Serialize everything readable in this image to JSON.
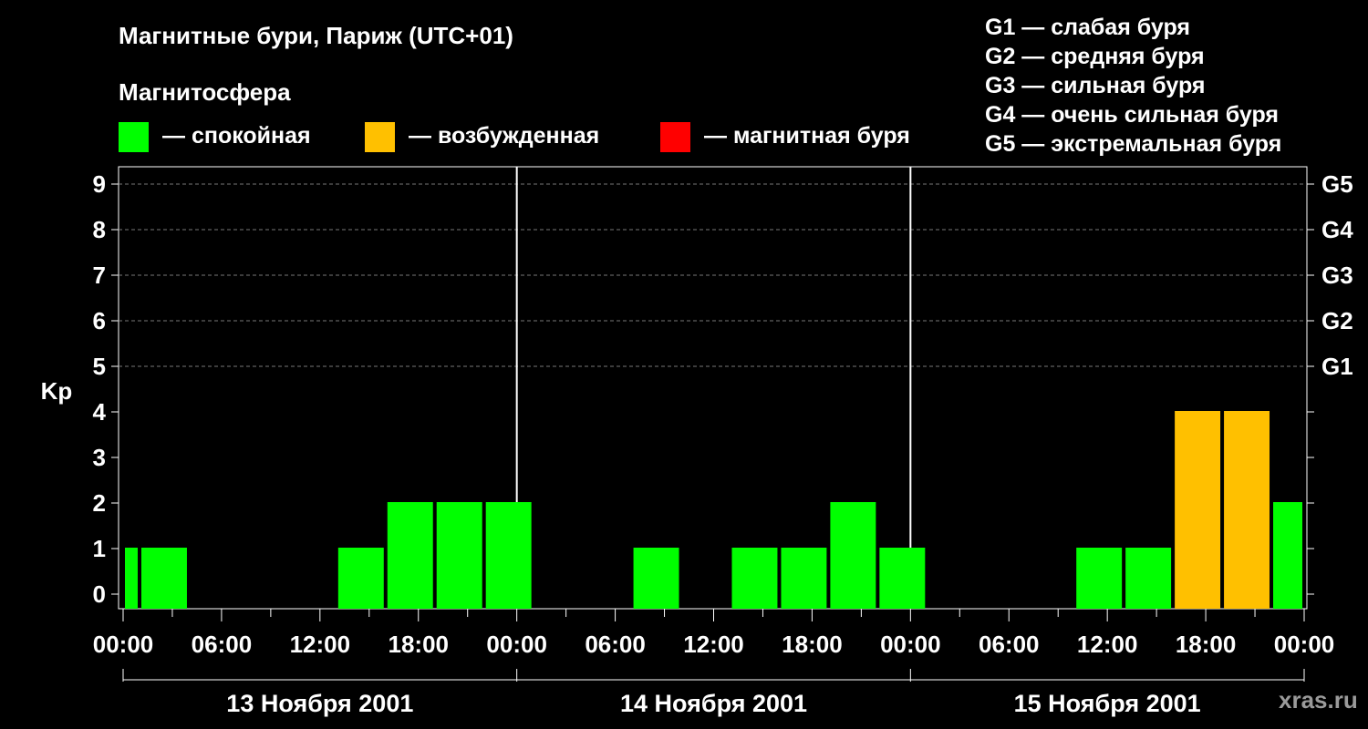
{
  "title": "Магнитные бури, Париж (UTC+01)",
  "subtitle": "Магнитосфера",
  "legend": [
    {
      "label": "— спокойная",
      "color": "#00ff00"
    },
    {
      "label": "— возбужденная",
      "color": "#ffc000"
    },
    {
      "label": "— магнитная буря",
      "color": "#ff0000"
    }
  ],
  "g_legend": [
    "G1 — слабая буря",
    "G2 — средняя буря",
    "G3 — сильная буря",
    "G4 — очень сильная буря",
    "G5 — экстремальная буря"
  ],
  "watermark": "xras.ru",
  "chart_data": {
    "type": "bar",
    "title": "Магнитные бури, Париж (UTC+01)",
    "ylabel": "Kp",
    "ylim": [
      0,
      9
    ],
    "yticks": [
      0,
      1,
      2,
      3,
      4,
      5,
      6,
      7,
      8,
      9
    ],
    "right_ticks": [
      {
        "value": 5,
        "label": "G1"
      },
      {
        "value": 6,
        "label": "G2"
      },
      {
        "value": 7,
        "label": "G3"
      },
      {
        "value": 8,
        "label": "G4"
      },
      {
        "value": 9,
        "label": "G5"
      }
    ],
    "grid": "dashed horizontal lines at Kp 5–9",
    "x_tick_labels": [
      "00:00",
      "06:00",
      "12:00",
      "18:00",
      "00:00",
      "06:00",
      "12:00",
      "18:00",
      "00:00",
      "06:00",
      "12:00",
      "18:00",
      "00:00"
    ],
    "dates": [
      "13 Ноября 2001",
      "14 Ноября 2001",
      "15 Ноября 2001"
    ],
    "bars": [
      {
        "day": "13 Ноября 2001",
        "start": "00:00",
        "end": "01:00",
        "kp": 1,
        "level": "спокойная"
      },
      {
        "day": "13 Ноября 2001",
        "start": "01:00",
        "end": "04:00",
        "kp": 1,
        "level": "спокойная"
      },
      {
        "day": "13 Ноября 2001",
        "start": "13:00",
        "end": "16:00",
        "kp": 1,
        "level": "спокойная"
      },
      {
        "day": "13 Ноября 2001",
        "start": "16:00",
        "end": "19:00",
        "kp": 2,
        "level": "спокойная"
      },
      {
        "day": "13 Ноября 2001",
        "start": "19:00",
        "end": "22:00",
        "kp": 2,
        "level": "спокойная"
      },
      {
        "day": "13 Ноября 2001",
        "start": "22:00",
        "end": "01:00",
        "kp": 2,
        "level": "спокойная"
      },
      {
        "day": "14 Ноября 2001",
        "start": "07:00",
        "end": "10:00",
        "kp": 1,
        "level": "спокойная"
      },
      {
        "day": "14 Ноября 2001",
        "start": "13:00",
        "end": "16:00",
        "kp": 1,
        "level": "спокойная"
      },
      {
        "day": "14 Ноября 2001",
        "start": "16:00",
        "end": "19:00",
        "kp": 1,
        "level": "спокойная"
      },
      {
        "day": "14 Ноября 2001",
        "start": "19:00",
        "end": "22:00",
        "kp": 2,
        "level": "спокойная"
      },
      {
        "day": "14 Ноября 2001",
        "start": "22:00",
        "end": "01:00",
        "kp": 1,
        "level": "спокойная"
      },
      {
        "day": "15 Ноября 2001",
        "start": "10:00",
        "end": "13:00",
        "kp": 1,
        "level": "спокойная"
      },
      {
        "day": "15 Ноября 2001",
        "start": "13:00",
        "end": "16:00",
        "kp": 1,
        "level": "спокойная"
      },
      {
        "day": "15 Ноября 2001",
        "start": "16:00",
        "end": "19:00",
        "kp": 4,
        "level": "возбужденная"
      },
      {
        "day": "15 Ноября 2001",
        "start": "19:00",
        "end": "22:00",
        "kp": 4,
        "level": "возбужденная"
      },
      {
        "day": "15 Ноября 2001",
        "start": "22:00",
        "end": "24:00",
        "kp": 2,
        "level": "спокойная"
      }
    ],
    "colors": {
      "спокойная": "#00ff00",
      "возбужденная": "#ffc000",
      "магнитная буря": "#ff0000"
    }
  }
}
